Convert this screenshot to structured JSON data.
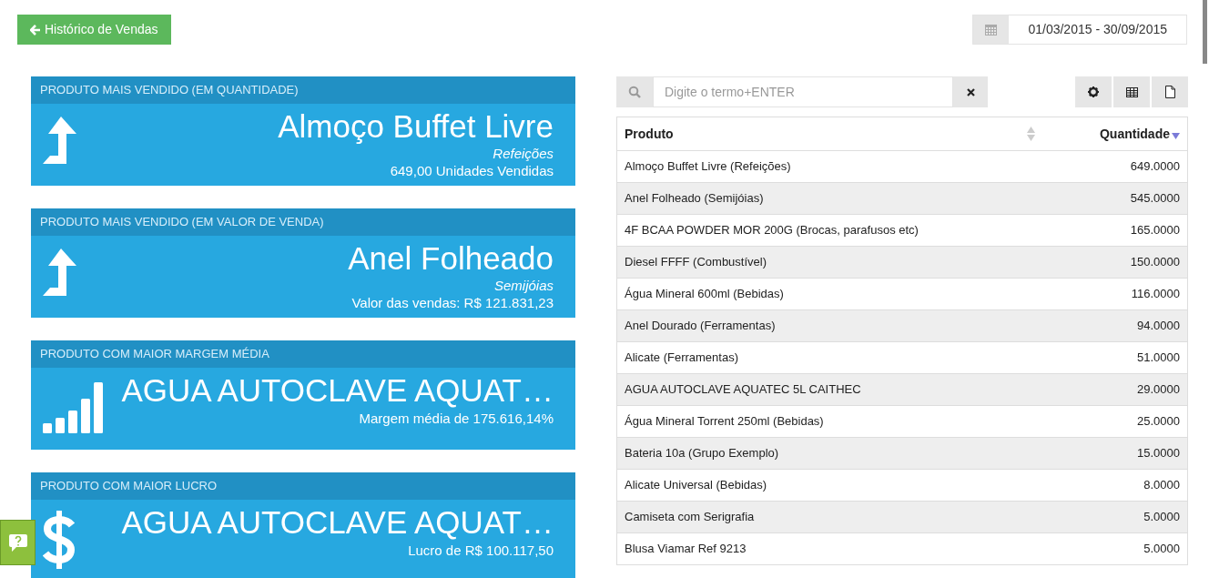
{
  "back_button": {
    "label": "Histórico de Vendas"
  },
  "date_range": {
    "value": "01/03/2015 - 30/09/2015"
  },
  "cards": [
    {
      "header": "PRODUTO MAIS VENDIDO (EM QUANTIDADE)",
      "kind": "arrow",
      "title": "Almoço Buffet Livre",
      "subtitle": "Refeições",
      "detail": "649,00 Unidades Vendidas"
    },
    {
      "header": "PRODUTO MAIS VENDIDO (EM VALOR DE VENDA)",
      "kind": "arrow",
      "title": "Anel Folheado",
      "subtitle": "Semijóias",
      "detail": "Valor das vendas: R$ 121.831,23"
    },
    {
      "header": "PRODUTO COM MAIOR MARGEM MÉDIA",
      "kind": "bars",
      "title": "AGUA AUTOCLAVE AQUAT…",
      "detail": "Margem média de 175.616,14%"
    },
    {
      "header": "PRODUTO COM MAIOR LUCRO",
      "kind": "dollar",
      "title": "AGUA AUTOCLAVE AQUAT…",
      "detail": "Lucro de R$ 100.117,50"
    }
  ],
  "search": {
    "placeholder": "Digite o termo+ENTER"
  },
  "table": {
    "columns": [
      {
        "label": "Produto",
        "sorted": false
      },
      {
        "label": "Quantidade",
        "sorted": true
      }
    ],
    "rows": [
      [
        "Almoço Buffet Livre (Refeições)",
        "649.0000"
      ],
      [
        "Anel Folheado (Semijóias)",
        "545.0000"
      ],
      [
        "4F BCAA POWDER MOR 200G (Brocas, parafusos etc)",
        "165.0000"
      ],
      [
        "Diesel FFFF (Combustível)",
        "150.0000"
      ],
      [
        "Água Mineral 600ml (Bebidas)",
        "116.0000"
      ],
      [
        "Anel Dourado (Ferramentas)",
        "94.0000"
      ],
      [
        "Alicate (Ferramentas)",
        "51.0000"
      ],
      [
        "AGUA AUTOCLAVE AQUATEC 5L CAITHEC",
        "29.0000"
      ],
      [
        "Água Mineral Torrent 250ml (Bebidas)",
        "25.0000"
      ],
      [
        "Bateria 10a (Grupo Exemplo)",
        "15.0000"
      ],
      [
        "Alicate Universal (Bebidas)",
        "8.0000"
      ],
      [
        "Camiseta com Serigrafia",
        "5.0000"
      ],
      [
        "Blusa Viamar Ref 9213",
        "5.0000"
      ]
    ]
  }
}
